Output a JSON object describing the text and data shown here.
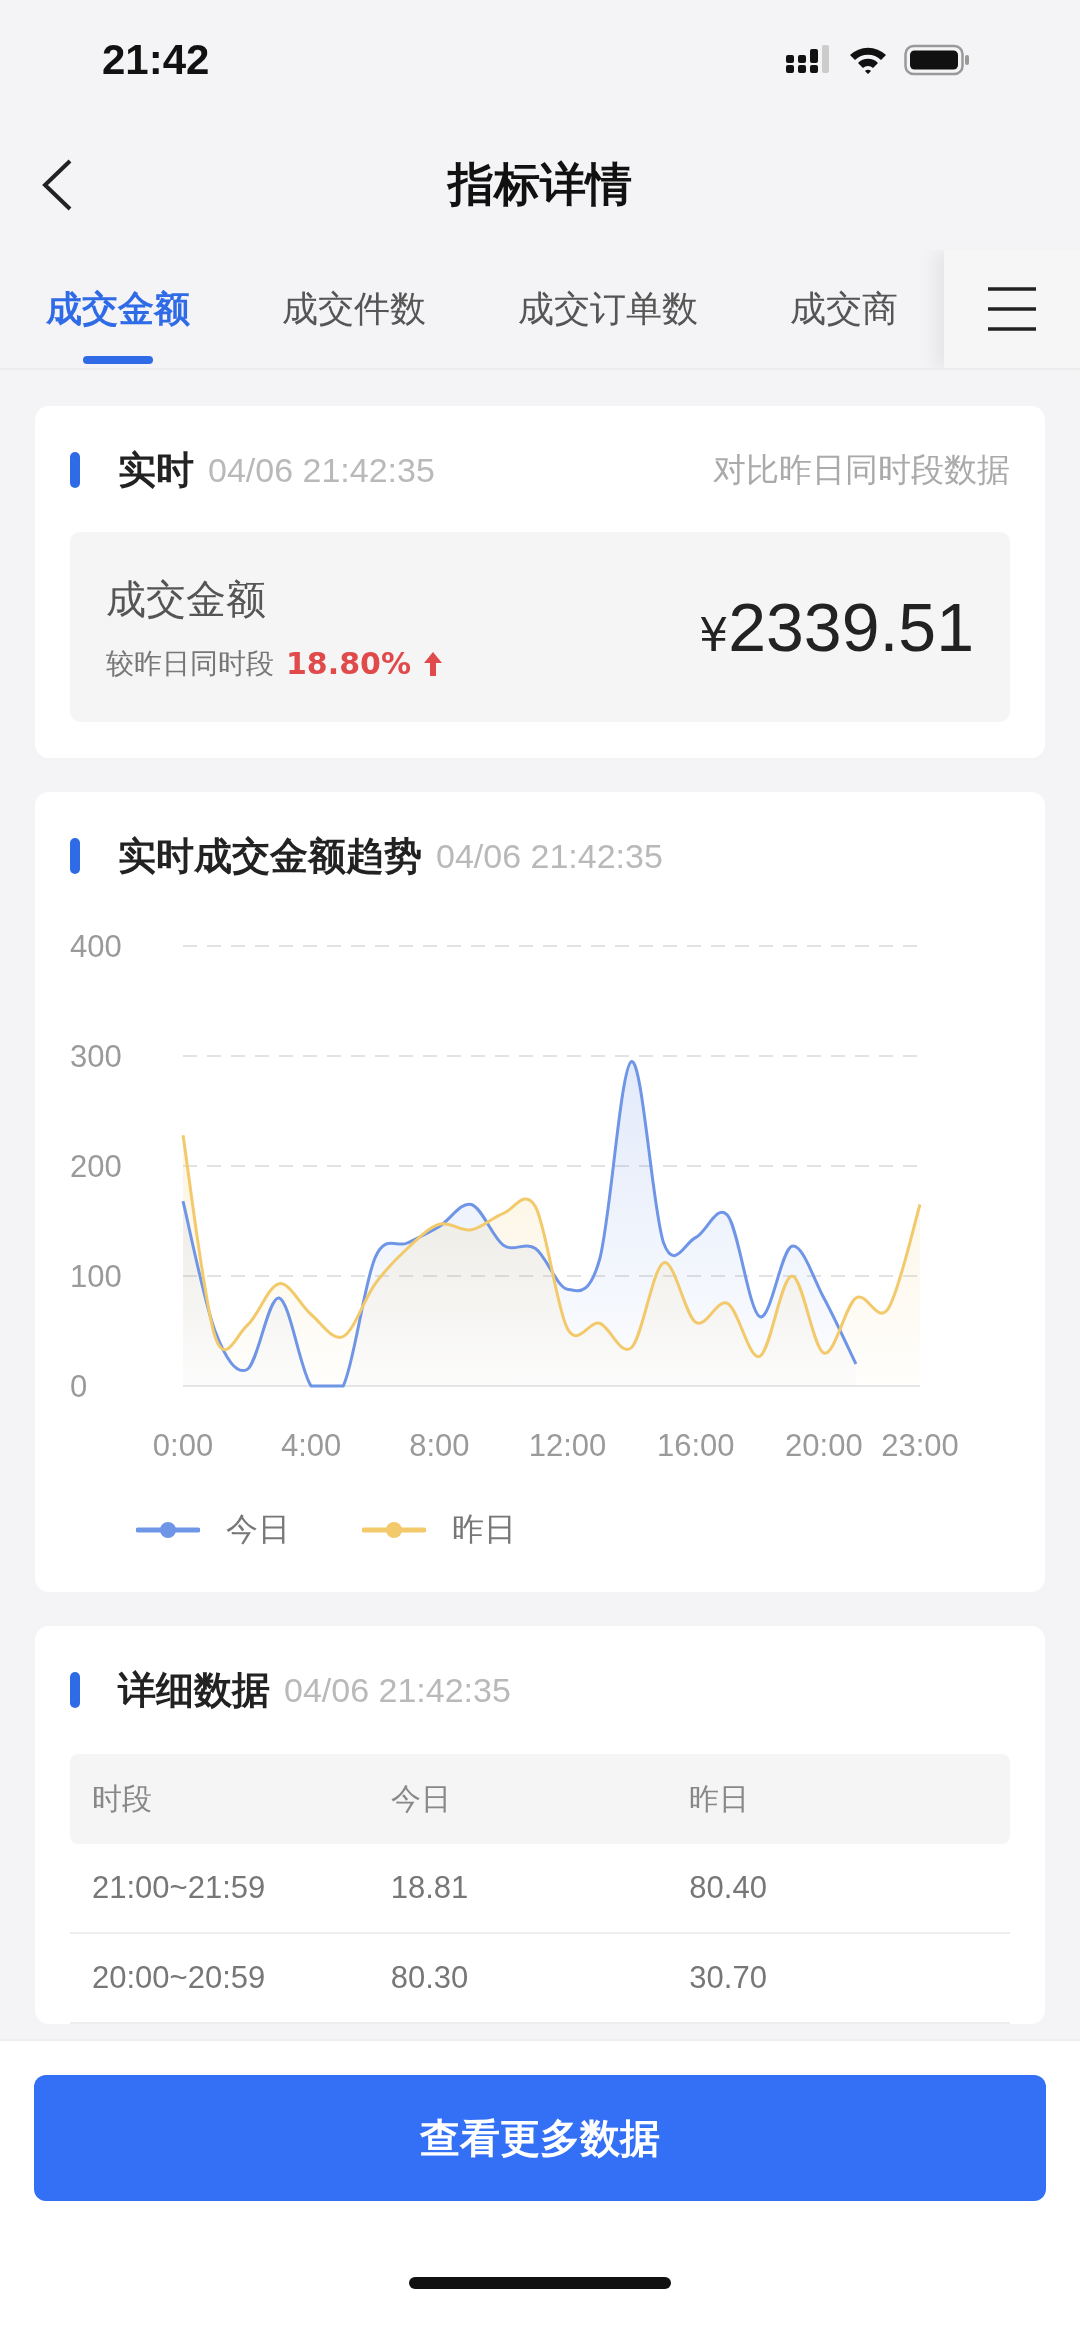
{
  "status_bar": {
    "time": "21:42"
  },
  "nav": {
    "title": "指标详情"
  },
  "tabs": [
    {
      "label": "成交金额",
      "selected": true
    },
    {
      "label": "成交件数",
      "selected": false
    },
    {
      "label": "成交订单数",
      "selected": false
    },
    {
      "label": "成交商",
      "selected": false
    }
  ],
  "realtime": {
    "title": "实时",
    "timestamp": "04/06 21:42:35",
    "compare_link": "对比昨日同时段数据",
    "metric_label": "成交金额",
    "compare_label": "较昨日同时段",
    "change": "18.80%",
    "rising": true,
    "currency": "¥",
    "value": "2339.51"
  },
  "trend_card": {
    "title": "实时成交金额趋势",
    "timestamp": "04/06 21:42:35",
    "chart_data": {
      "type": "area",
      "grid": true,
      "legend": true,
      "x": [
        0,
        1,
        2,
        3,
        4,
        5,
        6,
        7,
        8,
        9,
        10,
        11,
        12,
        13,
        14,
        15,
        16,
        17,
        18,
        19,
        20,
        21,
        22,
        23
      ],
      "series": [
        {
          "name": "今日",
          "color": "#6f95e6",
          "values": [
            168,
            50,
            15,
            80,
            0,
            0,
            117,
            130,
            145,
            165,
            128,
            125,
            88,
            115,
            295,
            130,
            135,
            155,
            63,
            127,
            80,
            20,
            null,
            null
          ]
        },
        {
          "name": "昨日",
          "color": "#f2c96b",
          "values": [
            228,
            45,
            55,
            93,
            65,
            45,
            93,
            125,
            147,
            142,
            157,
            163,
            52,
            57,
            35,
            112,
            58,
            75,
            27,
            100,
            30,
            80,
            70,
            165
          ]
        }
      ],
      "xlim": [
        0,
        23
      ],
      "ylim": [
        0,
        400
      ],
      "xticks": [
        {
          "value": 0,
          "label": "0:00"
        },
        {
          "value": 4,
          "label": "4:00"
        },
        {
          "value": 8,
          "label": "8:00"
        },
        {
          "value": 12,
          "label": "12:00"
        },
        {
          "value": 16,
          "label": "16:00"
        },
        {
          "value": 20,
          "label": "20:00"
        },
        {
          "value": 23,
          "label": "23:00"
        }
      ],
      "yticks": [
        0,
        100,
        200,
        300,
        400
      ]
    }
  },
  "detail": {
    "title": "详细数据",
    "timestamp": "04/06 21:42:35",
    "columns": [
      "时段",
      "今日",
      "昨日"
    ],
    "rows": [
      [
        "21:00~21:59",
        "18.81",
        "80.40"
      ],
      [
        "20:00~20:59",
        "80.30",
        "30.70"
      ]
    ]
  },
  "button": "查看更多数据"
}
